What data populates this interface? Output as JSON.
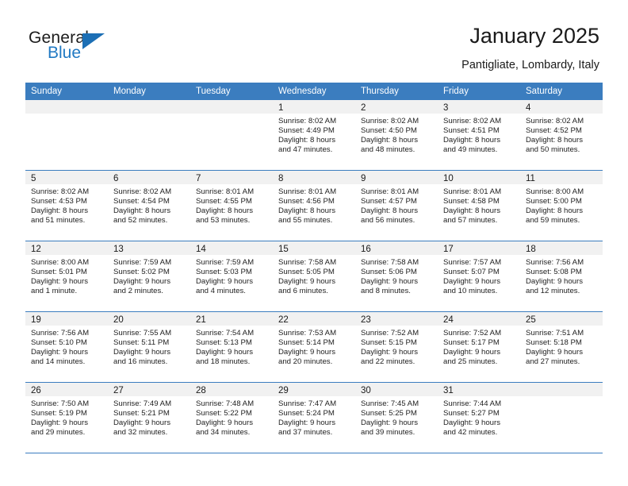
{
  "brand": {
    "name_part1": "General",
    "name_part2": "Blue",
    "accent_color": "#2079c3",
    "triangle_color": "#1c6fb5"
  },
  "header": {
    "title": "January 2025",
    "subtitle": "Pantigliate, Lombardy, Italy"
  },
  "calendar": {
    "header_bg": "#3b7dbf",
    "weekdays": [
      "Sunday",
      "Monday",
      "Tuesday",
      "Wednesday",
      "Thursday",
      "Friday",
      "Saturday"
    ],
    "weeks": [
      [
        {
          "day": "",
          "lines": []
        },
        {
          "day": "",
          "lines": []
        },
        {
          "day": "",
          "lines": []
        },
        {
          "day": "1",
          "lines": [
            "Sunrise: 8:02 AM",
            "Sunset: 4:49 PM",
            "Daylight: 8 hours",
            "and 47 minutes."
          ]
        },
        {
          "day": "2",
          "lines": [
            "Sunrise: 8:02 AM",
            "Sunset: 4:50 PM",
            "Daylight: 8 hours",
            "and 48 minutes."
          ]
        },
        {
          "day": "3",
          "lines": [
            "Sunrise: 8:02 AM",
            "Sunset: 4:51 PM",
            "Daylight: 8 hours",
            "and 49 minutes."
          ]
        },
        {
          "day": "4",
          "lines": [
            "Sunrise: 8:02 AM",
            "Sunset: 4:52 PM",
            "Daylight: 8 hours",
            "and 50 minutes."
          ]
        }
      ],
      [
        {
          "day": "5",
          "lines": [
            "Sunrise: 8:02 AM",
            "Sunset: 4:53 PM",
            "Daylight: 8 hours",
            "and 51 minutes."
          ]
        },
        {
          "day": "6",
          "lines": [
            "Sunrise: 8:02 AM",
            "Sunset: 4:54 PM",
            "Daylight: 8 hours",
            "and 52 minutes."
          ]
        },
        {
          "day": "7",
          "lines": [
            "Sunrise: 8:01 AM",
            "Sunset: 4:55 PM",
            "Daylight: 8 hours",
            "and 53 minutes."
          ]
        },
        {
          "day": "8",
          "lines": [
            "Sunrise: 8:01 AM",
            "Sunset: 4:56 PM",
            "Daylight: 8 hours",
            "and 55 minutes."
          ]
        },
        {
          "day": "9",
          "lines": [
            "Sunrise: 8:01 AM",
            "Sunset: 4:57 PM",
            "Daylight: 8 hours",
            "and 56 minutes."
          ]
        },
        {
          "day": "10",
          "lines": [
            "Sunrise: 8:01 AM",
            "Sunset: 4:58 PM",
            "Daylight: 8 hours",
            "and 57 minutes."
          ]
        },
        {
          "day": "11",
          "lines": [
            "Sunrise: 8:00 AM",
            "Sunset: 5:00 PM",
            "Daylight: 8 hours",
            "and 59 minutes."
          ]
        }
      ],
      [
        {
          "day": "12",
          "lines": [
            "Sunrise: 8:00 AM",
            "Sunset: 5:01 PM",
            "Daylight: 9 hours",
            "and 1 minute."
          ]
        },
        {
          "day": "13",
          "lines": [
            "Sunrise: 7:59 AM",
            "Sunset: 5:02 PM",
            "Daylight: 9 hours",
            "and 2 minutes."
          ]
        },
        {
          "day": "14",
          "lines": [
            "Sunrise: 7:59 AM",
            "Sunset: 5:03 PM",
            "Daylight: 9 hours",
            "and 4 minutes."
          ]
        },
        {
          "day": "15",
          "lines": [
            "Sunrise: 7:58 AM",
            "Sunset: 5:05 PM",
            "Daylight: 9 hours",
            "and 6 minutes."
          ]
        },
        {
          "day": "16",
          "lines": [
            "Sunrise: 7:58 AM",
            "Sunset: 5:06 PM",
            "Daylight: 9 hours",
            "and 8 minutes."
          ]
        },
        {
          "day": "17",
          "lines": [
            "Sunrise: 7:57 AM",
            "Sunset: 5:07 PM",
            "Daylight: 9 hours",
            "and 10 minutes."
          ]
        },
        {
          "day": "18",
          "lines": [
            "Sunrise: 7:56 AM",
            "Sunset: 5:08 PM",
            "Daylight: 9 hours",
            "and 12 minutes."
          ]
        }
      ],
      [
        {
          "day": "19",
          "lines": [
            "Sunrise: 7:56 AM",
            "Sunset: 5:10 PM",
            "Daylight: 9 hours",
            "and 14 minutes."
          ]
        },
        {
          "day": "20",
          "lines": [
            "Sunrise: 7:55 AM",
            "Sunset: 5:11 PM",
            "Daylight: 9 hours",
            "and 16 minutes."
          ]
        },
        {
          "day": "21",
          "lines": [
            "Sunrise: 7:54 AM",
            "Sunset: 5:13 PM",
            "Daylight: 9 hours",
            "and 18 minutes."
          ]
        },
        {
          "day": "22",
          "lines": [
            "Sunrise: 7:53 AM",
            "Sunset: 5:14 PM",
            "Daylight: 9 hours",
            "and 20 minutes."
          ]
        },
        {
          "day": "23",
          "lines": [
            "Sunrise: 7:52 AM",
            "Sunset: 5:15 PM",
            "Daylight: 9 hours",
            "and 22 minutes."
          ]
        },
        {
          "day": "24",
          "lines": [
            "Sunrise: 7:52 AM",
            "Sunset: 5:17 PM",
            "Daylight: 9 hours",
            "and 25 minutes."
          ]
        },
        {
          "day": "25",
          "lines": [
            "Sunrise: 7:51 AM",
            "Sunset: 5:18 PM",
            "Daylight: 9 hours",
            "and 27 minutes."
          ]
        }
      ],
      [
        {
          "day": "26",
          "lines": [
            "Sunrise: 7:50 AM",
            "Sunset: 5:19 PM",
            "Daylight: 9 hours",
            "and 29 minutes."
          ]
        },
        {
          "day": "27",
          "lines": [
            "Sunrise: 7:49 AM",
            "Sunset: 5:21 PM",
            "Daylight: 9 hours",
            "and 32 minutes."
          ]
        },
        {
          "day": "28",
          "lines": [
            "Sunrise: 7:48 AM",
            "Sunset: 5:22 PM",
            "Daylight: 9 hours",
            "and 34 minutes."
          ]
        },
        {
          "day": "29",
          "lines": [
            "Sunrise: 7:47 AM",
            "Sunset: 5:24 PM",
            "Daylight: 9 hours",
            "and 37 minutes."
          ]
        },
        {
          "day": "30",
          "lines": [
            "Sunrise: 7:45 AM",
            "Sunset: 5:25 PM",
            "Daylight: 9 hours",
            "and 39 minutes."
          ]
        },
        {
          "day": "31",
          "lines": [
            "Sunrise: 7:44 AM",
            "Sunset: 5:27 PM",
            "Daylight: 9 hours",
            "and 42 minutes."
          ]
        },
        {
          "day": "",
          "lines": []
        }
      ]
    ]
  }
}
